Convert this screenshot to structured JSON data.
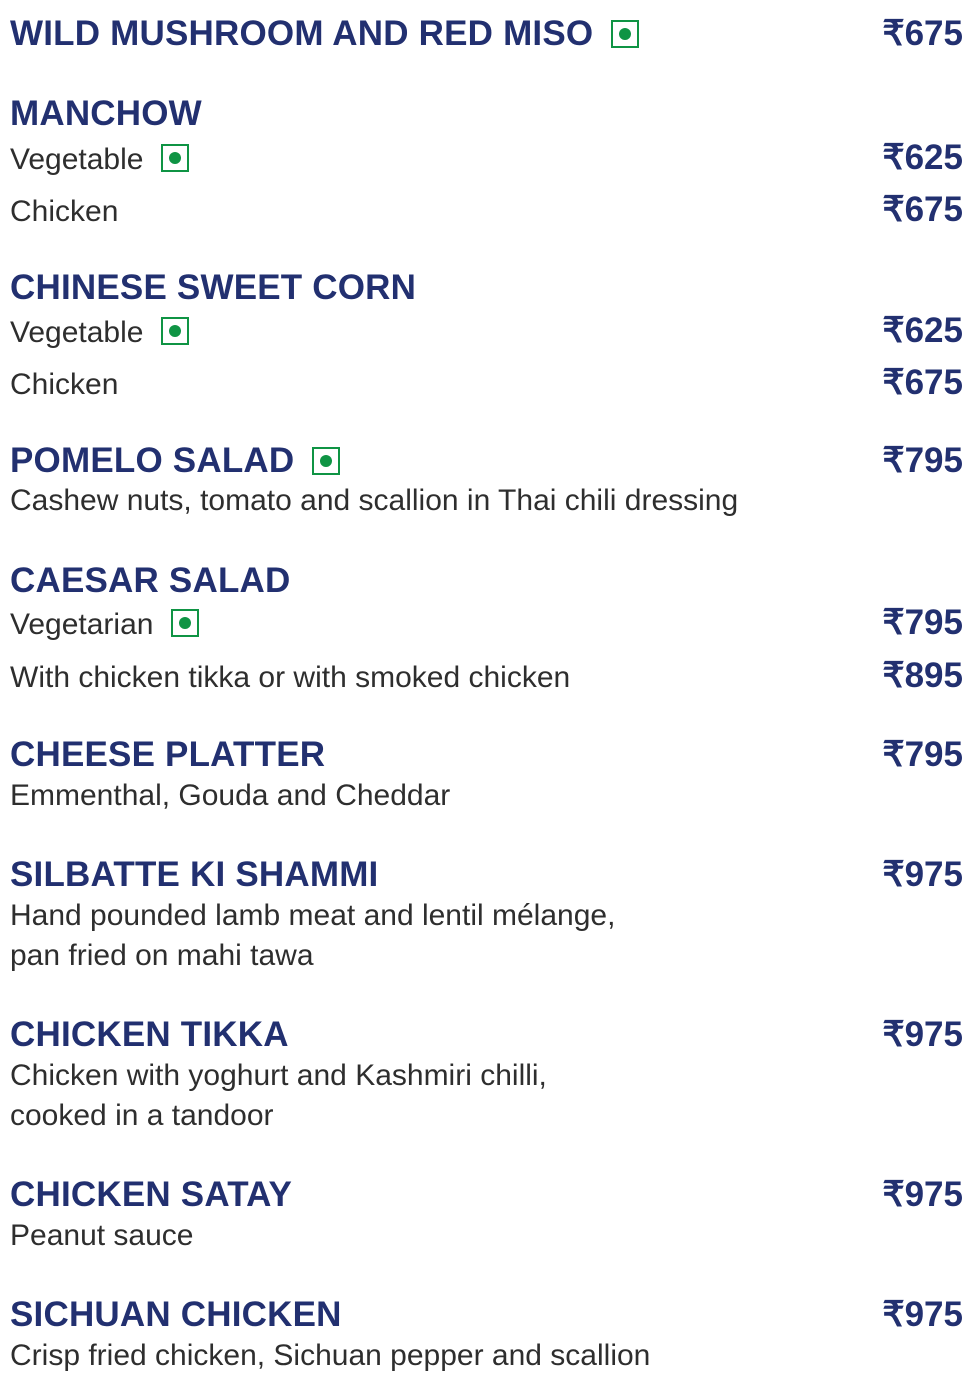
{
  "menu": {
    "items": [
      {
        "name": "WILD MUSHROOM AND RED MISO",
        "veg": true,
        "price": "₹675"
      },
      {
        "name": "MANCHOW",
        "options": [
          {
            "label": "Vegetable",
            "veg": true,
            "price": "₹625"
          },
          {
            "label": "Chicken",
            "price": "₹675"
          }
        ]
      },
      {
        "name": "CHINESE SWEET CORN",
        "options": [
          {
            "label": "Vegetable",
            "veg": true,
            "price": "₹625"
          },
          {
            "label": "Chicken",
            "price": "₹675"
          }
        ]
      },
      {
        "name": "POMELO SALAD",
        "veg": true,
        "price": "₹795",
        "description": "Cashew nuts, tomato and scallion in Thai chili dressing"
      },
      {
        "name": "CAESAR SALAD",
        "options": [
          {
            "label": "Vegetarian",
            "veg": true,
            "price": "₹795"
          },
          {
            "label": "With chicken tikka or with smoked chicken",
            "price": "₹895"
          }
        ]
      },
      {
        "name": "CHEESE PLATTER",
        "price": "₹795",
        "description": "Emmenthal, Gouda and Cheddar"
      },
      {
        "name": "SILBATTE KI SHAMMI",
        "price": "₹975",
        "description_lines": [
          "Hand pounded lamb meat and lentil mélange,",
          "pan fried on mahi tawa"
        ]
      },
      {
        "name": "CHICKEN TIKKA",
        "price": "₹975",
        "description_lines": [
          "Chicken with yoghurt and Kashmiri chilli,",
          "cooked in a tandoor"
        ]
      },
      {
        "name": "CHICKEN SATAY",
        "price": "₹975",
        "description": "Peanut sauce"
      },
      {
        "name": "SICHUAN CHICKEN",
        "price": "₹975",
        "description": "Crisp fried chicken, Sichuan pepper and scallion"
      }
    ]
  },
  "colors": {
    "title": "#223070",
    "body_text": "#2e2e2e",
    "veg_mark": "#0f9444",
    "background": "#ffffff"
  },
  "icons": {
    "veg_mark": "veg-symbol-icon"
  }
}
